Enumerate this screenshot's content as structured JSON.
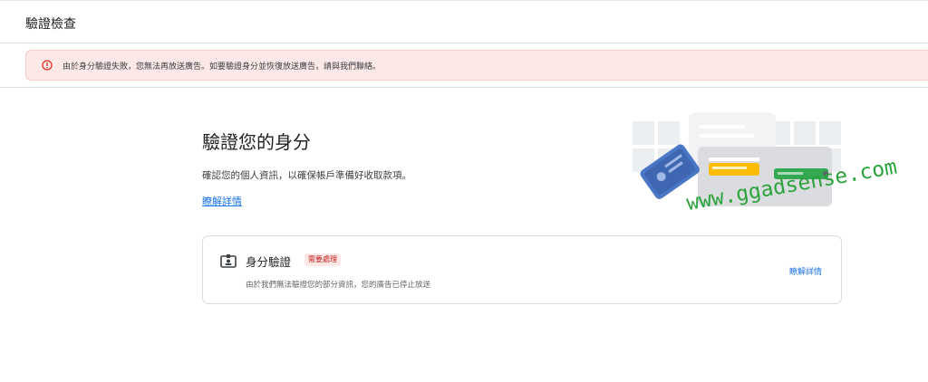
{
  "header": {
    "title": "驗證檢查"
  },
  "alert": {
    "message": "由於身分驗證失敗，您無法再放送廣告。如要驗證身分並恢復放送廣告，請與我們聯絡。",
    "color": "#d93025"
  },
  "main": {
    "title": "驗證您的身分",
    "description": "確認您的個人資訊，以確保帳戶準備好收取款項。",
    "learn_more": "瞭解詳情"
  },
  "card": {
    "title": "身分驗證",
    "badge": "需要處理",
    "description": "由於我們無法驗證您的部分資訊，您的廣告已停止放送",
    "learn_more": "瞭解詳情"
  },
  "watermark": {
    "text": "www.ggadsense.com",
    "color": "#2aa43a"
  },
  "colors": {
    "accent": "#1a73e8",
    "alert_bg": "#fce8e6",
    "badge_text": "#c5221f"
  },
  "icons": {
    "alert": "error-circle-icon",
    "card": "id-badge-icon",
    "illustration": "identity-documents-illustration"
  }
}
